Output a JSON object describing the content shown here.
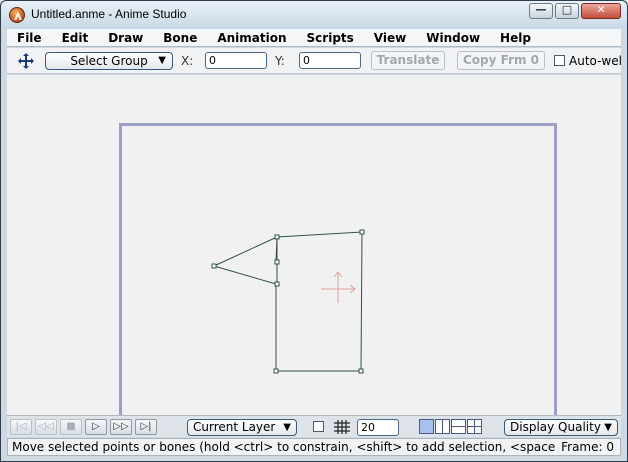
{
  "window": {
    "title": "Untitled.anme - Anime Studio",
    "minimize_glyph": "—",
    "maximize_glyph": "□",
    "close_glyph": "✕"
  },
  "menu": [
    "File",
    "Edit",
    "Draw",
    "Bone",
    "Animation",
    "Scripts",
    "View",
    "Window",
    "Help"
  ],
  "toolbar": {
    "tool_icon": "move-arrows-icon",
    "select_group_label": "Select Group",
    "dropdown_glyph": "▼",
    "x_label": "X:",
    "x_value": "0",
    "y_label": "Y:",
    "y_value": "0",
    "translate_label": "Translate",
    "copy_frame_label": "Copy Frm 0",
    "autoweld_label": "Auto-wel"
  },
  "canvas": {
    "shape_stroke_color": "#2f4f4f",
    "crosshair_color": "#e0a0a0",
    "frame_border_color": "#9d9fc8"
  },
  "playback": {
    "buttons": [
      "rewind-to-start-icon",
      "step-back-icon",
      "stop-icon",
      "play-icon",
      "step-forward-icon",
      "fast-forward-icon"
    ],
    "glyphs": [
      "|◁",
      "◁◁",
      "■",
      "▷",
      "▷▷",
      "▷|"
    ]
  },
  "bottombar": {
    "layer_select_label": "Current Layer",
    "grid_size_value": "20",
    "quality_select_label": "Display Quality",
    "dropdown_glyph": "▼"
  },
  "status": {
    "message": "Move selected points or bones (hold <ctrl> to constrain, <shift> to add selection, <space> to",
    "frame_label": "Frame: 0"
  }
}
